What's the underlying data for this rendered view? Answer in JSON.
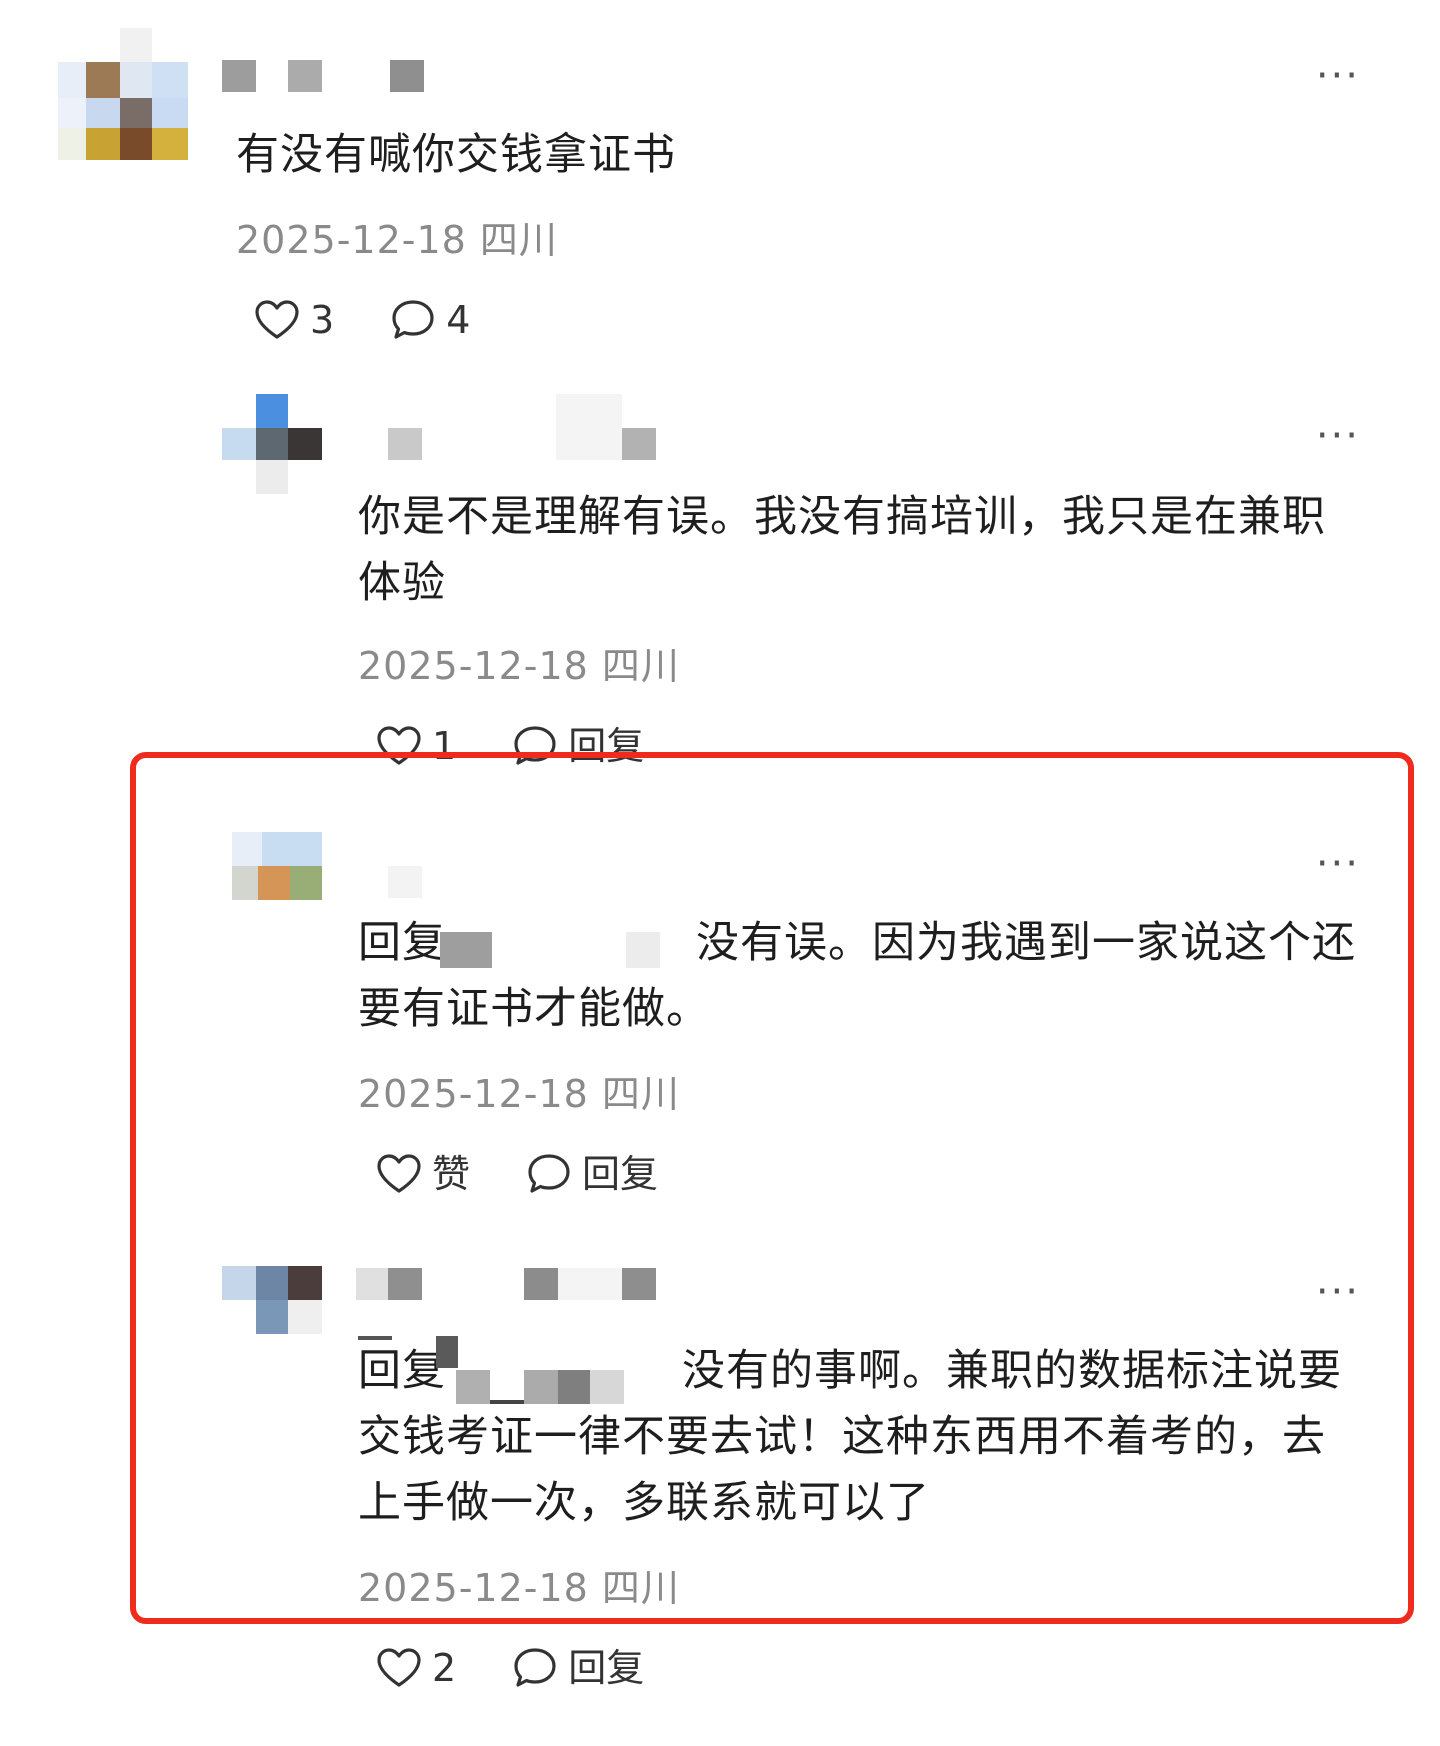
{
  "comments": [
    {
      "text": "有没有喊你交钱拿证书",
      "meta": "2025-12-18 四川",
      "likes": "3",
      "replies": "4"
    },
    {
      "text": "你是不是理解有误。我没有搞培训，我只是在兼职体验",
      "meta": "2025-12-18 四川",
      "likes": "1",
      "reply_label": "回复"
    },
    {
      "text_prefix": "回复",
      "text": "没有误。因为我遇到一家说这个还要有证书才能做。",
      "meta": "2025-12-18 四川",
      "like_label": "赞",
      "reply_label": "回复"
    },
    {
      "text_prefix": "回复",
      "text": "没有的事啊。兼职的数据标注说要交钱考证一律不要去试！这种东西用不着考的，去上手做一次，多联系就可以了",
      "meta": "2025-12-18 四川",
      "likes": "2",
      "reply_label": "回复"
    }
  ],
  "more_icon": "more-icon",
  "colors": {
    "highlight": "#ee2b1d",
    "meta": "#8a8a8a"
  }
}
